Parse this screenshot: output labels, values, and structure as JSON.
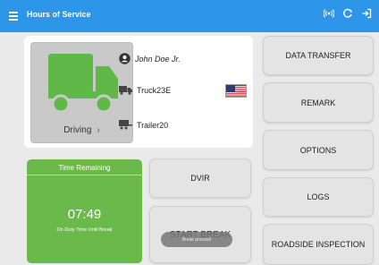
{
  "appbar": {
    "title": "Hours of Service",
    "icons": [
      "menu-icon",
      "broadcast-icon",
      "refresh-icon",
      "logout-icon"
    ]
  },
  "status": {
    "duty_status": "Driving",
    "driver_name": "John Doe Jr.",
    "truck": "Truck23E",
    "trailer": "Trailer20"
  },
  "time_card": {
    "title": "Time Remaining",
    "time": "07:49",
    "subtitle": "On Duty Time Until Break"
  },
  "buttons": {
    "dvir": "DVIR",
    "start_break": "START BREAK",
    "data_transfer": "DATA TRANSFER",
    "remark": "REMARK",
    "options": "OPTIONS",
    "logs": "LOGS",
    "roadside_inspection": "ROADSIDE INSPECTION"
  },
  "toast": {
    "text": "Break pressed"
  },
  "colors": {
    "appbar": "#2d96e8",
    "truck": "#5fb848",
    "time_card": "#6bb94b"
  }
}
